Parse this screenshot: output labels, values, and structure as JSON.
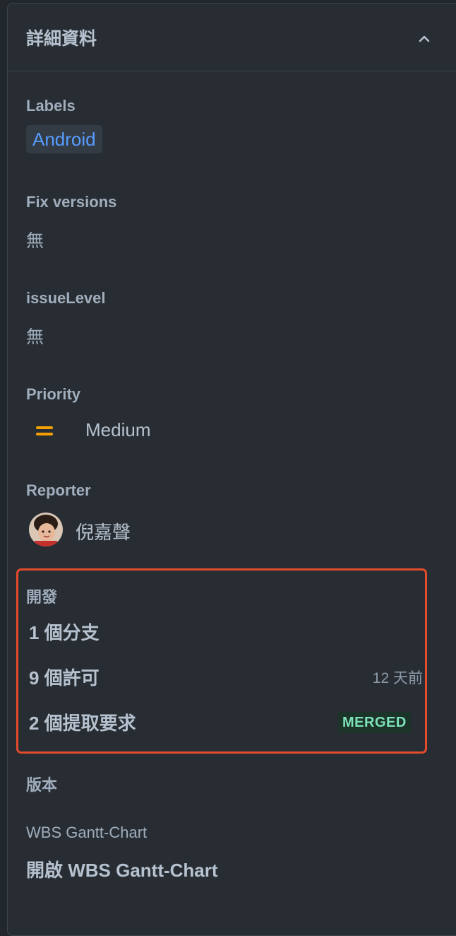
{
  "panel": {
    "title": "詳細資料"
  },
  "labels": {
    "label": "Labels",
    "tag": "Android"
  },
  "fix_versions": {
    "label": "Fix versions",
    "value": "無"
  },
  "issue_level": {
    "label": "issueLevel",
    "value": "無"
  },
  "priority": {
    "label": "Priority",
    "value": "Medium",
    "color": "#f5a000"
  },
  "reporter": {
    "label": "Reporter",
    "name": "倪嘉聲"
  },
  "development": {
    "title": "開發",
    "branches": "1 個分支",
    "commits": "9 個許可",
    "commits_time": "12 天前",
    "pull_requests": "2 個提取要求",
    "pr_status": "MERGED"
  },
  "version": {
    "label": "版本"
  },
  "wbs": {
    "label": "WBS Gantt-Chart",
    "link": "開啟 WBS Gantt-Chart"
  },
  "colors": {
    "background": "#22272b",
    "panel": "#282d33",
    "accent_link": "#579dff",
    "highlight_border": "#e34b2c",
    "merged_text": "#7ee2b8"
  }
}
